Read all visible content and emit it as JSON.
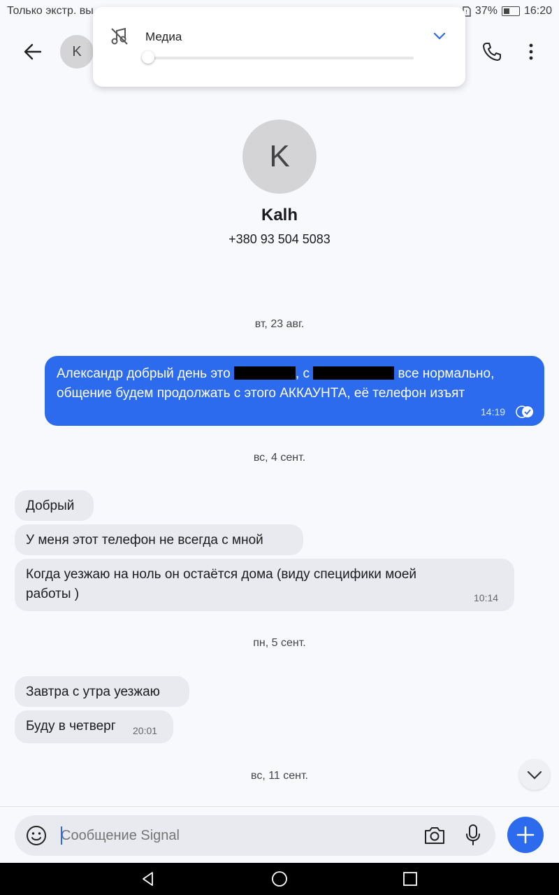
{
  "status_bar": {
    "left_text": "Только экстр. вы",
    "battery": "37%",
    "time": "16:20"
  },
  "header": {
    "avatar_initial": "K"
  },
  "media_popup": {
    "label": "Медиа",
    "volume_fraction": 0.0
  },
  "profile": {
    "initial": "K",
    "name": "Kalh",
    "phone": "+380 93 504 5083"
  },
  "conversation": {
    "date_1": "вт, 23 авг.",
    "outgoing": {
      "part1": "Александр добрый день это ",
      "part2": ", с ",
      "part3": " все нормально,",
      "line2": "общение будем продолжать с этого АККАУНТА, её телефон изъят",
      "time": "14:19"
    },
    "date_2": "вс, 4 сент.",
    "msg_1": "Добрый",
    "msg_2": "У меня этот телефон не всегда с мной",
    "msg_3_line1": "Когда уезжаю на ноль он остаётся дома (виду специфики моей",
    "msg_3_line2": "работы )",
    "msg_3_time": "10:14",
    "date_3": "пн, 5 сент.",
    "msg_4": "Завтра с утра уезжаю",
    "msg_5": "Буду в четверг",
    "msg_5_time": "20:01",
    "date_4": "вс, 11 сент."
  },
  "composer": {
    "placeholder": "Сообщение Signal"
  },
  "colors": {
    "accent": "#2c6bed",
    "incoming_bubble": "#e8eaf0",
    "background": "#f8f9fd"
  }
}
